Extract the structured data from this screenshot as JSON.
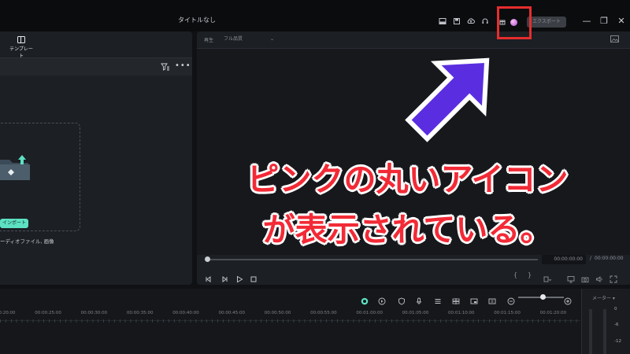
{
  "window": {
    "title": "タイトルなし",
    "export_label": "エクスポート",
    "min_glyph": "—",
    "restore_glyph": "❐",
    "close_glyph": "✕"
  },
  "titlebar_icons": [
    "layout-icon",
    "save-icon",
    "cloud-upload-icon",
    "headset-icon",
    "gift-icon",
    "profile-avatar-icon"
  ],
  "left_panel": {
    "tab_label": "テンプレート",
    "import_button": "インポート",
    "import_hint": "ーディオファイル, 画像",
    "more_glyph": "•••"
  },
  "player": {
    "mode_label": "再生",
    "quality": "フル品質",
    "current_time": "00:00:00:00",
    "separator": "/",
    "total_time": "00:00:00:00",
    "mark_in_glyph": "{",
    "mark_out_glyph": "}"
  },
  "timeline": {
    "ticks": [
      "00:00:20:00",
      "00:00:25:00",
      "00:00:30:00",
      "00:00:35:00",
      "00:00:40:00",
      "00:00:45:00",
      "00:00:50:00",
      "00:00:55:00",
      "00:01:00:00",
      "00:01:05:00",
      "00:01:10:00",
      "00:01:15:00",
      "00:01:20:00",
      "00:01:25:00"
    ],
    "meter_label": "メーター ▾",
    "meter_scale": [
      "0",
      "-6",
      "-12"
    ],
    "zoom_level": 0.48
  },
  "annotation": {
    "line1": "ピンクの丸いアイコン",
    "line2": "が表示されている。",
    "highlight_color": "#e62d2d",
    "arrow_color": "#5a2ee0",
    "text_color": "#f22a36"
  }
}
